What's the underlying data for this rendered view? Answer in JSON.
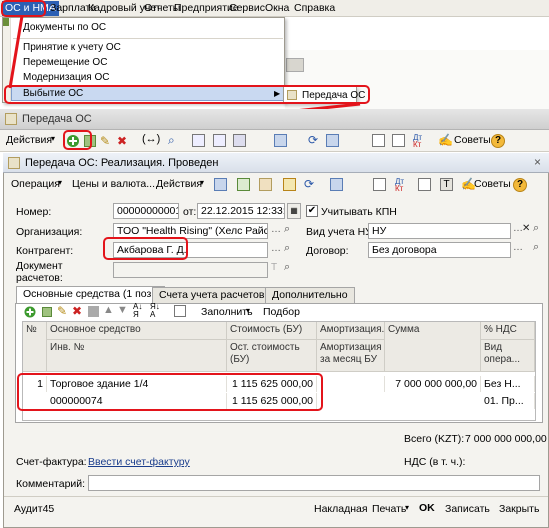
{
  "menu": {
    "items": [
      "ОС и НМА",
      "Зарплата",
      "Кадровый учет",
      "Отчеты",
      "Предприятие",
      "Сервис",
      "Окна",
      "Справка"
    ]
  },
  "dropdown": {
    "items": [
      "Документы по ОС",
      "Принятие к учету ОС",
      "Перемещение ОС",
      "Модернизация ОС",
      "Выбытие ОС"
    ],
    "submenu_item": "Передача ОС"
  },
  "window1": {
    "title": "Передача ОС",
    "actions_label": "Действия"
  },
  "form": {
    "title": "Передача ОС: Реализация. Проведен",
    "toolbar": {
      "operation": "Операция",
      "prices": "Цены и валюта...",
      "actions": "Действия",
      "tips": "Советы"
    },
    "number_label": "Номер:",
    "number_value": "00000000001",
    "date_label": "от:",
    "date_value": "22.12.2015 12:33:20",
    "kpn_label": "Учитывать КПН",
    "org_label": "Организация:",
    "org_value": "ТОО \"Health Rising\" (Хелс Райсинг)",
    "nu_label": "Вид учета НУ:",
    "nu_value": "НУ",
    "contractor_label": "Контрагент:",
    "contractor_value": "Акбарова Г. Д.",
    "contract_label": "Договор:",
    "contract_value": "Без договора",
    "doc_label_1": "Документ",
    "doc_label_2": "расчетов:",
    "tabs": [
      "Основные средства (1 поз.)",
      "Счета учета расчетов",
      "Дополнительно"
    ],
    "grid_toolbar": {
      "fill": "Заполнить",
      "select": "Подбор"
    },
    "grid_headers": {
      "num": "№",
      "os": "Основное средство",
      "inv": "Инв. №",
      "cost": "Стоимость (БУ)",
      "rest_cost": "Ост. стоимость (БУ)",
      "amort": "Амортизация...",
      "amort_month": "Амортизация за месяц БУ",
      "sum": "Сумма",
      "vat": "% НДС",
      "vat2": "Вид опера..."
    },
    "rows": [
      {
        "num": "1",
        "name": "Торговое здание 1/4",
        "inv": "000000074",
        "cost": "1 115 625 000,00",
        "rest_cost": "1 115 625 000,00",
        "sum": "7 000 000 000,00",
        "vat": "Без Н...",
        "vat2": "01. Пр..."
      }
    ],
    "total_label": "Всего (KZT):",
    "total_value": "7 000 000 000,00",
    "vat_label": "НДС (в т. ч.):",
    "invoice_label": "Счет-фактура:",
    "invoice_link": "Ввести счет-фактуру",
    "comment_label": "Комментарий:",
    "footer": {
      "user": "Аудит45",
      "invoice": "Накладная",
      "print": "Печать",
      "ok": "OK",
      "save": "Записать",
      "close": "Закрыть"
    }
  },
  "colors": {
    "highlight_red": "#e3141b",
    "menu_active": "#2b5fb4"
  }
}
